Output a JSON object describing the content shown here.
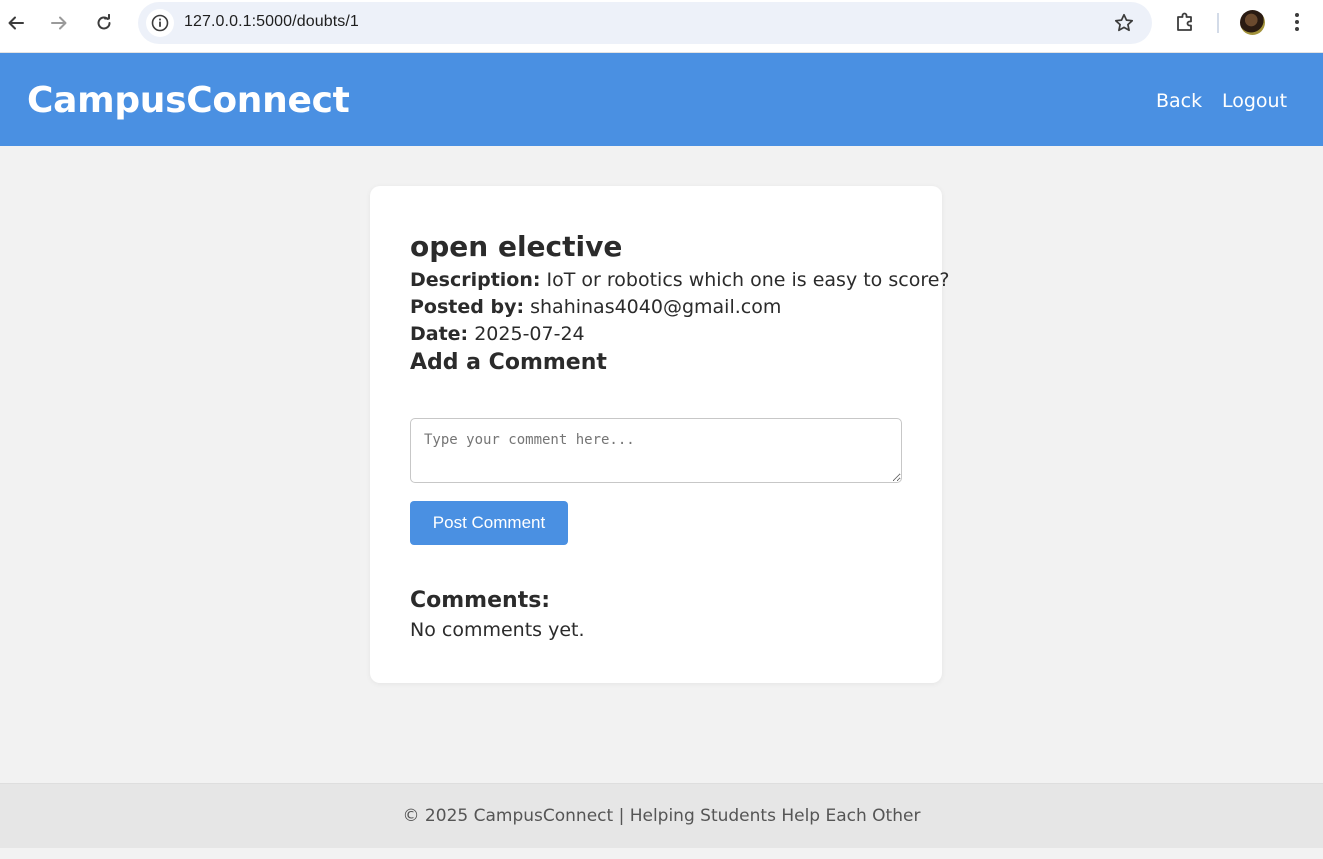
{
  "browser": {
    "url": "127.0.0.1:5000/doubts/1",
    "icons": [
      "back-arrow-icon",
      "forward-arrow-icon",
      "reload-icon",
      "site-info-icon",
      "bookmark-star-icon",
      "extensions-icon",
      "profile-avatar",
      "more-menu-icon"
    ]
  },
  "header": {
    "brand": "CampusConnect",
    "nav": {
      "back": "Back",
      "logout": "Logout"
    },
    "color": "#4a90e2"
  },
  "doubt": {
    "title": "open elective",
    "description_label": "Description:",
    "description": "IoT or robotics which one is easy to score?",
    "posted_by_label": "Posted by:",
    "posted_by": "shahinas4040@gmail.com",
    "date_label": "Date:",
    "date": "2025-07-24"
  },
  "comment_form": {
    "heading": "Add a Comment",
    "placeholder": "Type your comment here...",
    "value": "",
    "submit_label": "Post Comment"
  },
  "comments": {
    "heading": "Comments:",
    "empty_text": "No comments yet.",
    "items": []
  },
  "footer": {
    "text": "© 2025 CampusConnect | Helping Students Help Each Other"
  }
}
